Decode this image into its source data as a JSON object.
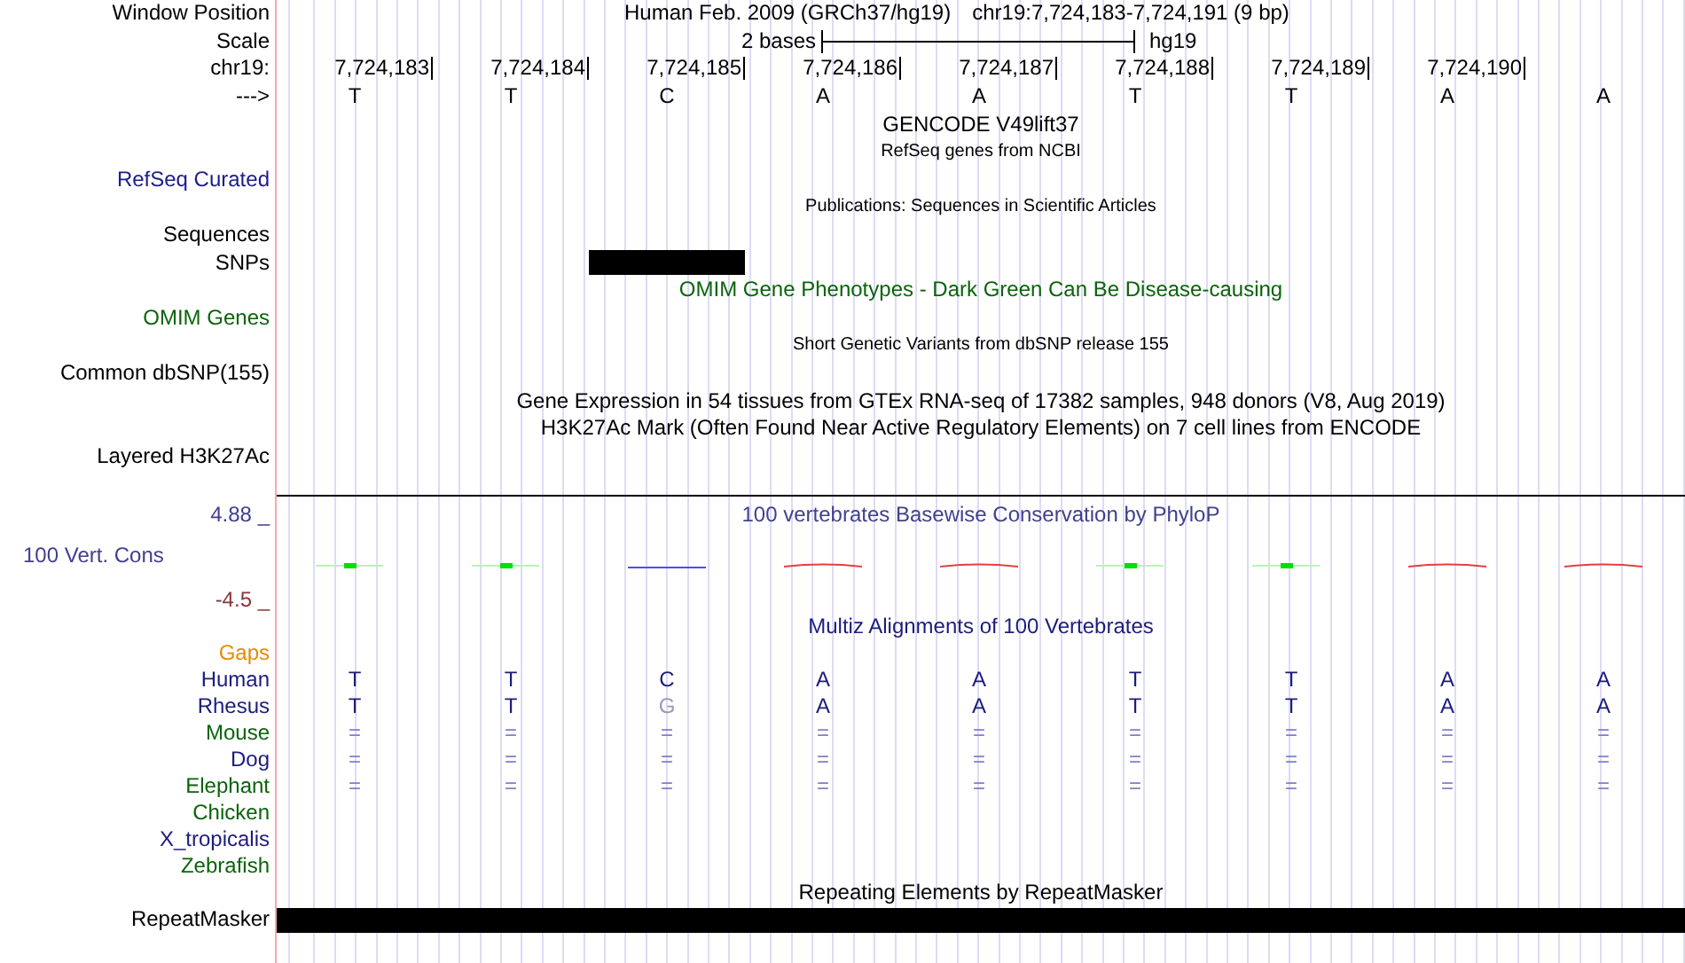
{
  "window_position": {
    "label": "Window Position",
    "assembly": "Human Feb. 2009 (GRCh37/hg19)",
    "range": "chr19:7,724,183-7,724,191 (9 bp)"
  },
  "scale": {
    "label": "Scale",
    "length": "2 bases",
    "assembly": "hg19"
  },
  "ruler": {
    "label": "chr19:",
    "ticks": [
      "7,724,183",
      "7,724,184",
      "7,724,185",
      "7,724,186",
      "7,724,187",
      "7,724,188",
      "7,724,189",
      "7,724,190"
    ]
  },
  "sequence": {
    "label": "--->",
    "bases": [
      "T",
      "T",
      "C",
      "A",
      "A",
      "T",
      "T",
      "A",
      "A"
    ]
  },
  "tracks": [
    {
      "kind": "title",
      "text": "GENCODE V49lift37",
      "color": "#000000"
    },
    {
      "kind": "subtitle",
      "text": "RefSeq genes from NCBI",
      "color": "#000000"
    },
    {
      "kind": "label",
      "text": "RefSeq Curated",
      "color": "#1c1c8c"
    },
    {
      "kind": "subtitle",
      "text": "Publications: Sequences in Scientific Articles",
      "color": "#000000"
    },
    {
      "kind": "label",
      "text": "Sequences",
      "color": "#000000"
    },
    {
      "kind": "feature",
      "text": "SNPs",
      "color": "#000000",
      "coverage": [
        false,
        false,
        true,
        false,
        false,
        false,
        false,
        false,
        false
      ]
    },
    {
      "kind": "title",
      "text": "OMIM Gene Phenotypes - Dark Green Can Be Disease-causing",
      "color": "#0a640a"
    },
    {
      "kind": "label",
      "text": "OMIM Genes",
      "color": "#0a640a"
    },
    {
      "kind": "subtitle",
      "text": "Short Genetic Variants from dbSNP release 155",
      "color": "#000000"
    },
    {
      "kind": "label",
      "text": "Common dbSNP(155)",
      "color": "#000000"
    },
    {
      "kind": "title",
      "text": "Gene Expression in 54 tissues from GTEx RNA-seq of 17382 samples, 948 donors (V8, Aug 2019)",
      "color": "#000000"
    },
    {
      "kind": "title",
      "text": "H3K27Ac Mark (Often Found Near Active Regulatory Elements) on 7 cell lines from ENCODE",
      "color": "#000000"
    },
    {
      "kind": "label",
      "text": "Layered H3K27Ac",
      "color": "#000000"
    }
  ],
  "conservation": {
    "label": "100 Vert. Cons",
    "title": "100 vertebrates Basewise Conservation by PhyloP",
    "max": "4.88 _",
    "min": "-4.5 _",
    "marks": [
      {
        "kind": "up"
      },
      {
        "kind": "up"
      },
      {
        "kind": "flat"
      },
      {
        "kind": "down"
      },
      {
        "kind": "down"
      },
      {
        "kind": "up"
      },
      {
        "kind": "up"
      },
      {
        "kind": "down"
      },
      {
        "kind": "down"
      }
    ]
  },
  "alignment": {
    "title": "Multiz Alignments of 100 Vertebrates",
    "species": [
      {
        "name": "Gaps",
        "color": "#e88a00"
      },
      {
        "name": "Human",
        "color": "#1c1c7c",
        "bases": [
          {
            "text": "T",
            "kind": "base"
          },
          {
            "text": "T",
            "kind": "base"
          },
          {
            "text": "C",
            "kind": "base"
          },
          {
            "text": "A",
            "kind": "base"
          },
          {
            "text": "A",
            "kind": "base"
          },
          {
            "text": "T",
            "kind": "base"
          },
          {
            "text": "T",
            "kind": "base"
          },
          {
            "text": "A",
            "kind": "base"
          },
          {
            "text": "A",
            "kind": "base"
          }
        ]
      },
      {
        "name": "Rhesus",
        "color": "#1c1c7c",
        "bases": [
          {
            "text": "T",
            "kind": "base"
          },
          {
            "text": "T",
            "kind": "base"
          },
          {
            "text": "G",
            "kind": "diff"
          },
          {
            "text": "A",
            "kind": "base"
          },
          {
            "text": "A",
            "kind": "base"
          },
          {
            "text": "T",
            "kind": "base"
          },
          {
            "text": "T",
            "kind": "base"
          },
          {
            "text": "A",
            "kind": "base"
          },
          {
            "text": "A",
            "kind": "base"
          }
        ]
      },
      {
        "name": "Mouse",
        "color": "#0a640a",
        "bases": [
          {
            "text": "=",
            "kind": "same"
          },
          {
            "text": "=",
            "kind": "same"
          },
          {
            "text": "=",
            "kind": "same"
          },
          {
            "text": "=",
            "kind": "same"
          },
          {
            "text": "=",
            "kind": "same"
          },
          {
            "text": "=",
            "kind": "same"
          },
          {
            "text": "=",
            "kind": "same"
          },
          {
            "text": "=",
            "kind": "same"
          },
          {
            "text": "=",
            "kind": "same"
          }
        ]
      },
      {
        "name": "Dog",
        "color": "#1c1c7c",
        "bases": [
          {
            "text": "=",
            "kind": "same"
          },
          {
            "text": "=",
            "kind": "same"
          },
          {
            "text": "=",
            "kind": "same"
          },
          {
            "text": "=",
            "kind": "same"
          },
          {
            "text": "=",
            "kind": "same"
          },
          {
            "text": "=",
            "kind": "same"
          },
          {
            "text": "=",
            "kind": "same"
          },
          {
            "text": "=",
            "kind": "same"
          },
          {
            "text": "=",
            "kind": "same"
          }
        ]
      },
      {
        "name": "Elephant",
        "color": "#0a640a",
        "bases": [
          {
            "text": "=",
            "kind": "same"
          },
          {
            "text": "=",
            "kind": "same"
          },
          {
            "text": "=",
            "kind": "same"
          },
          {
            "text": "=",
            "kind": "same"
          },
          {
            "text": "=",
            "kind": "same"
          },
          {
            "text": "=",
            "kind": "same"
          },
          {
            "text": "=",
            "kind": "same"
          },
          {
            "text": "=",
            "kind": "same"
          },
          {
            "text": "=",
            "kind": "same"
          }
        ]
      },
      {
        "name": "Chicken",
        "color": "#0a640a"
      },
      {
        "name": "X_tropicalis",
        "color": "#1c1c7c"
      },
      {
        "name": "Zebrafish",
        "color": "#0a640a"
      }
    ]
  },
  "repeats": {
    "title": "Repeating Elements by RepeatMasker",
    "label": "RepeatMasker"
  }
}
